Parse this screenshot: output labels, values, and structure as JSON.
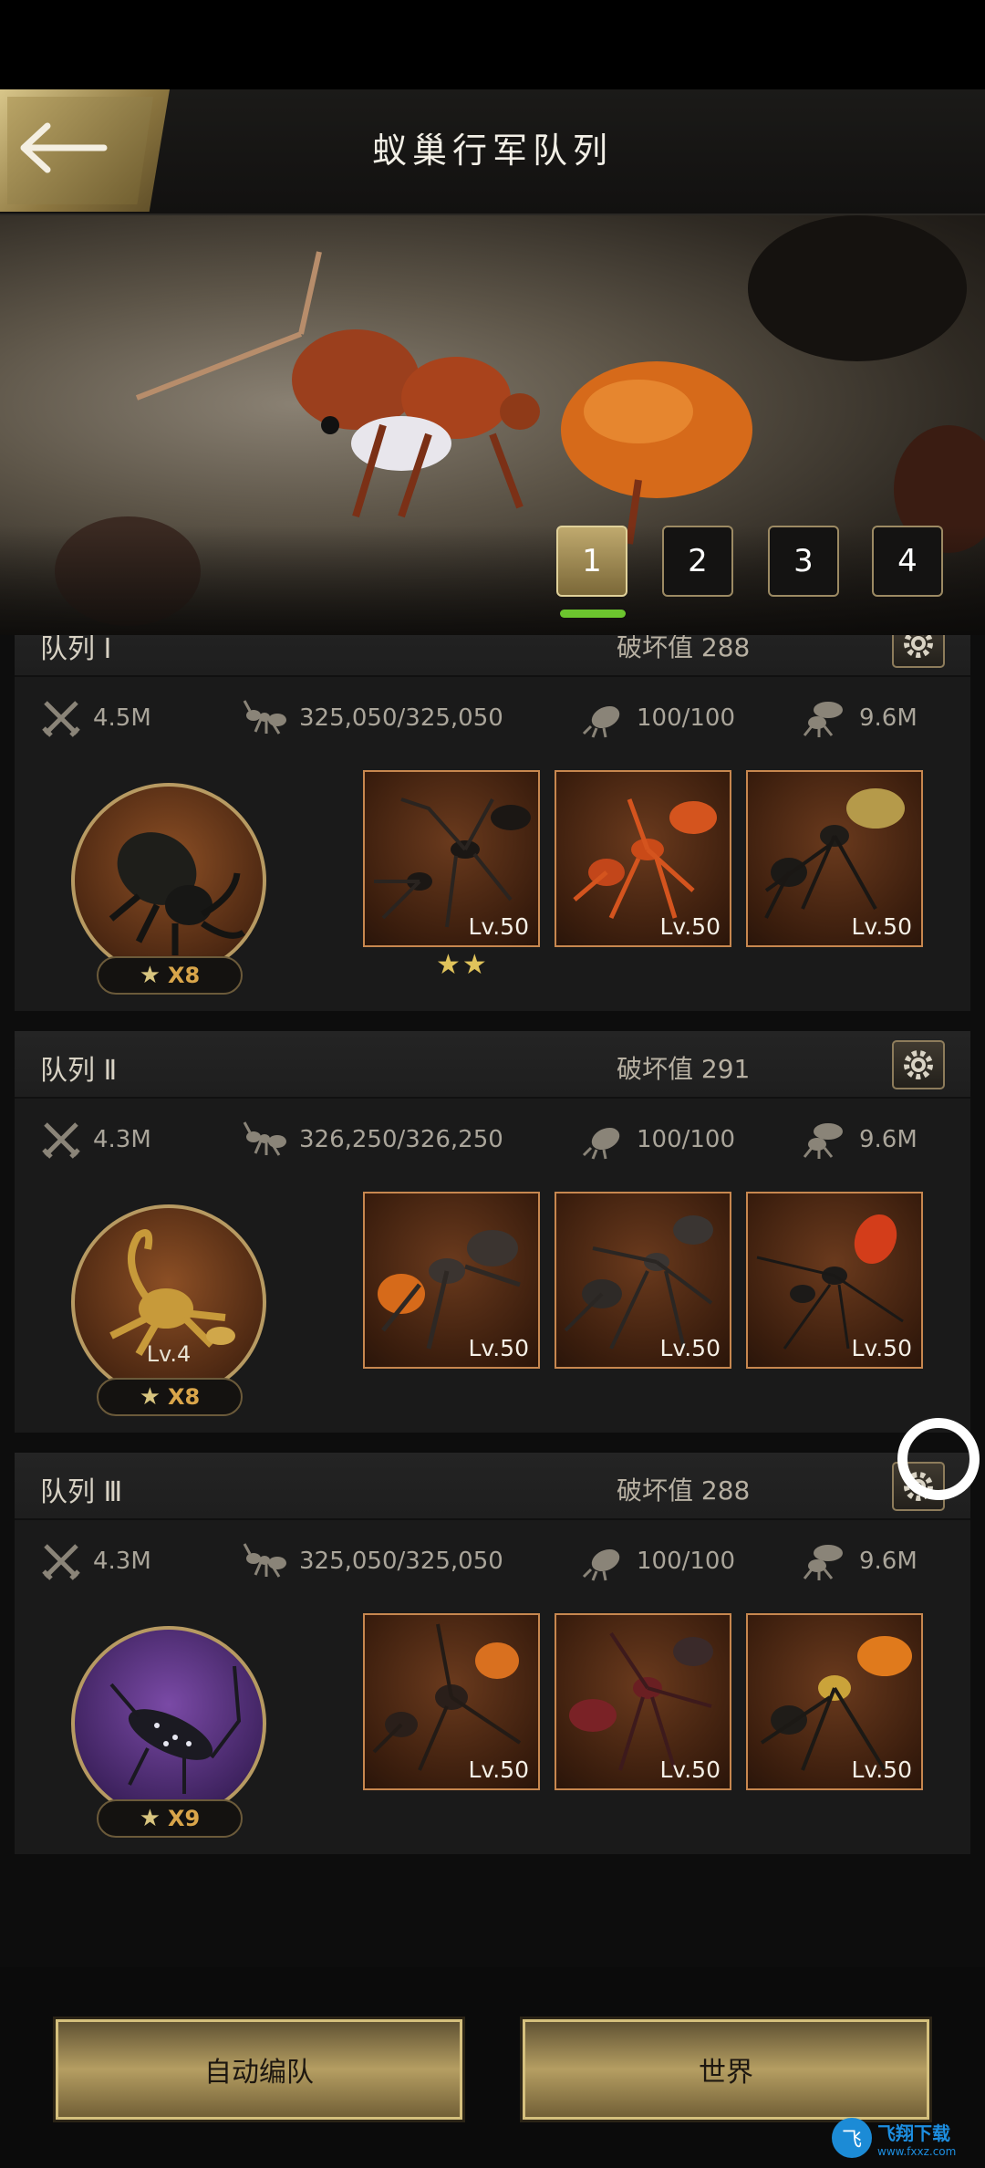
{
  "header": {
    "title": "蚁巢行军队列"
  },
  "tabs": [
    {
      "label": "1",
      "active": true
    },
    {
      "label": "2",
      "active": false
    },
    {
      "label": "3",
      "active": false
    },
    {
      "label": "4",
      "active": false
    }
  ],
  "squads": [
    {
      "name": "队列 Ⅰ",
      "damage": "破坏值 288",
      "attack": "4.5M",
      "troops": "325,050/325,050",
      "bugs": "100/100",
      "load": "9.6M",
      "leader": {
        "level": "",
        "multiplier": "X8",
        "theme": "brown"
      },
      "cards": [
        {
          "level": "Lv.50"
        },
        {
          "level": "Lv.50"
        },
        {
          "level": "Lv.50"
        }
      ],
      "card_stars": "★★"
    },
    {
      "name": "队列 Ⅱ",
      "damage": "破坏值 291",
      "attack": "4.3M",
      "troops": "326,250/326,250",
      "bugs": "100/100",
      "load": "9.6M",
      "leader": {
        "level": "Lv.4",
        "multiplier": "X8",
        "theme": "brown"
      },
      "cards": [
        {
          "level": "Lv.50"
        },
        {
          "level": "Lv.50"
        },
        {
          "level": "Lv.50"
        }
      ],
      "card_stars": ""
    },
    {
      "name": "队列 Ⅲ",
      "damage": "破坏值 288",
      "attack": "4.3M",
      "troops": "325,050/325,050",
      "bugs": "100/100",
      "load": "9.6M",
      "leader": {
        "level": "",
        "multiplier": "X9",
        "theme": "purple"
      },
      "cards": [
        {
          "level": "Lv.50"
        },
        {
          "level": "Lv.50"
        },
        {
          "level": "Lv.50"
        }
      ],
      "card_stars": ""
    }
  ],
  "buttons": {
    "auto_formation": "自动编队",
    "world": "世界"
  },
  "watermark": {
    "brand": "飞翔下载",
    "url": "www.fxxz.com",
    "logo_char": "飞"
  },
  "colors": {
    "accent_gold": "#b59e62",
    "tab_active_underline": "#6cc52e",
    "card_border": "#c7874f"
  },
  "icons": [
    "back-arrow-icon",
    "gear-icon",
    "crossed-swords-icon",
    "ant-icon",
    "beetle-icon",
    "ant-load-icon",
    "star-icon"
  ]
}
